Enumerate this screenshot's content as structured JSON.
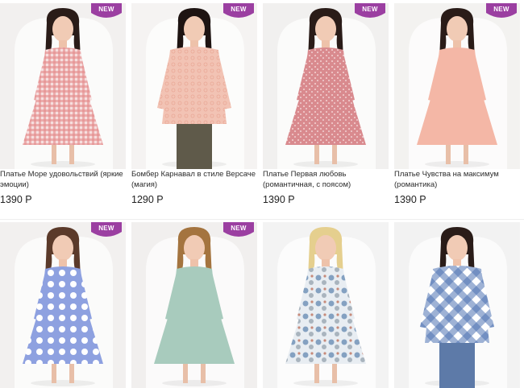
{
  "badge_label": "NEW",
  "colors": {
    "badge": "#9b3fa1"
  },
  "products": [
    {
      "title": "Платье Море удовольствий (яркие эмоции)",
      "price": "1390 Р",
      "new": true,
      "dress_color": "#e48b8b",
      "pattern": "gingham"
    },
    {
      "title": "Бомбер Карнавал в стиле Версаче (магия)",
      "price": "1290 Р",
      "new": true,
      "dress_color": "#f2c3b4",
      "pattern": "lace"
    },
    {
      "title": "Платье Первая любовь (романтичная, с поясом)",
      "price": "1390 Р",
      "new": true,
      "dress_color": "#d98a8e",
      "pattern": "print"
    },
    {
      "title": "Платье Чувства на максимум (романтика)",
      "price": "1390 Р",
      "new": true,
      "dress_color": "#f4b7a6",
      "pattern": "plain"
    },
    {
      "title": "",
      "price": "",
      "new": true,
      "dress_color": "#8ea1e0",
      "pattern": "dots"
    },
    {
      "title": "",
      "price": "",
      "new": true,
      "dress_color": "#a8cbbd",
      "pattern": "plain"
    },
    {
      "title": "",
      "price": "",
      "new": false,
      "dress_color": "#b9c6d6",
      "pattern": "geometric"
    },
    {
      "title": "",
      "price": "",
      "new": false,
      "dress_color": "#4e73b3",
      "pattern": "check"
    }
  ]
}
